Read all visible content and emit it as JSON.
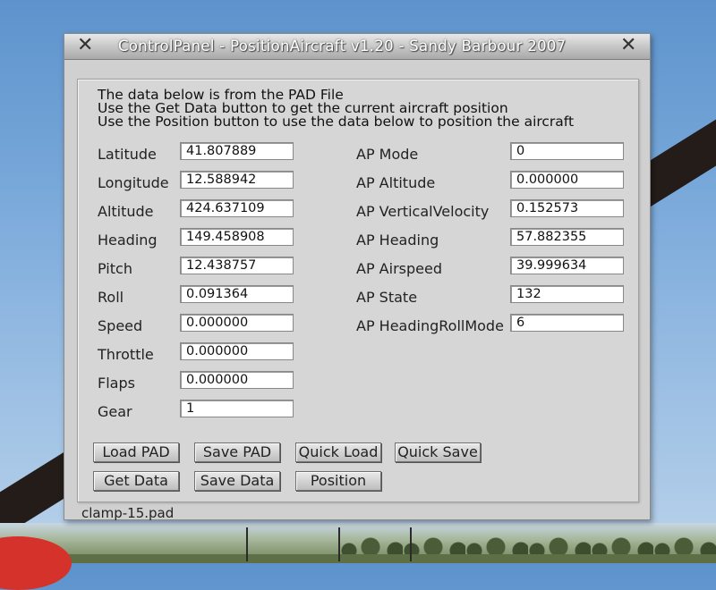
{
  "window": {
    "title": "ControlPanel - PositionAircraft v1.20 - Sandy Barbour 2007"
  },
  "info_lines": [
    "The data below is from the PAD File",
    "Use the Get Data button to get the current aircraft position",
    "Use the Position button to use the data below to position the aircraft"
  ],
  "left_fields": [
    {
      "label": "Latitude",
      "value": "41.807889"
    },
    {
      "label": "Longitude",
      "value": "12.588942"
    },
    {
      "label": "Altitude",
      "value": "424.637109"
    },
    {
      "label": "Heading",
      "value": "149.458908"
    },
    {
      "label": "Pitch",
      "value": "12.438757"
    },
    {
      "label": "Roll",
      "value": "0.091364"
    },
    {
      "label": "Speed",
      "value": "0.000000"
    },
    {
      "label": "Throttle",
      "value": "0.000000"
    },
    {
      "label": "Flaps",
      "value": "0.000000"
    },
    {
      "label": "Gear",
      "value": "1"
    }
  ],
  "right_fields": [
    {
      "label": "AP Mode",
      "value": "0"
    },
    {
      "label": "AP Altitude",
      "value": "0.000000"
    },
    {
      "label": "AP VerticalVelocity",
      "value": "0.152573"
    },
    {
      "label": "AP Heading",
      "value": "57.882355"
    },
    {
      "label": "AP Airspeed",
      "value": "39.999634"
    },
    {
      "label": "AP State",
      "value": "132"
    },
    {
      "label": "AP HeadingRollMode",
      "value": "6"
    }
  ],
  "buttons": {
    "load_pad": "Load PAD",
    "save_pad": "Save PAD",
    "quick_load": "Quick Load",
    "quick_save": "Quick Save",
    "get_data": "Get Data",
    "save_data": "Save Data",
    "position": "Position"
  },
  "status": {
    "filename": "clamp-15.pad"
  },
  "icons": {
    "close_left": "close-icon",
    "close_right": "close-icon"
  }
}
